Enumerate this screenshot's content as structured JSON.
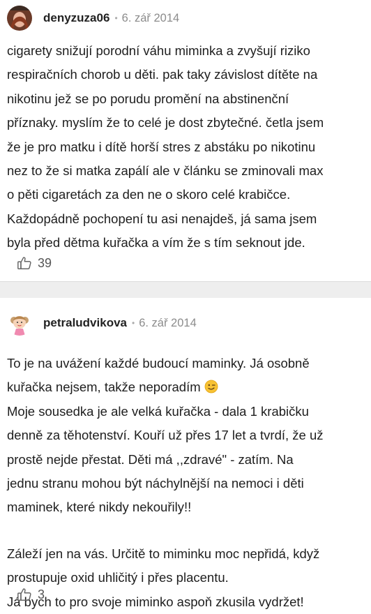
{
  "comments": [
    {
      "username": "denyzuza06",
      "date": "6. zář 2014",
      "lines": [
        "cigarety snižují porodní váhu miminka a zvyšují riziko",
        "respiračních chorob u děti. pak taky závislost dítěte na",
        "nikotinu jež se po porudu promění na abstinenční",
        "příznaky. myslím že to celé je dost zbytečné. četla jsem",
        "že je pro matku i dítě horší stres z abstáku po nikotinu",
        "nez to že si matka zapálí ale v článku se zminovali max",
        "o pěti cigaretách za den ne o skoro celé krabičce.",
        "Každopádně pochopení tu asi nenajdeš, já sama jsem",
        "byla před dětma kuřačka a vím že s tím seknout jde."
      ],
      "likes": "39"
    },
    {
      "username": "petraludvikova",
      "date": "6. zář 2014",
      "para1_lines": [
        "To je na uvážení každé budoucí maminky. Já osobně",
        "kuřačka nejsem, takže neporadím",
        "Moje sousedka je ale velká kuřačka - dala 1 krabičku",
        "denně za těhotenství. Kouří už přes 17 let a tvrdí, že už",
        "prostě nejde přestat. Děti má ,,zdravé\" - zatím. Na",
        "jednu stranu mohou být náchylnější na nemoci i děti",
        "maminek, které nikdy nekouřily!!"
      ],
      "para2_lines": [
        "Záleží jen na vás. Určitě to miminku moc nepřidá, když",
        "prostupuje oxid uhličitý i přes placentu.",
        "Já bych to pro svoje miminko aspoň zkusila vydržet!"
      ],
      "emoji": "winking-face",
      "likes": "3"
    }
  ],
  "icons": {
    "like": "thumbs-up-outline-icon"
  },
  "colors": {
    "divider": "#eeeeee",
    "muted": "#8c8c8c"
  }
}
